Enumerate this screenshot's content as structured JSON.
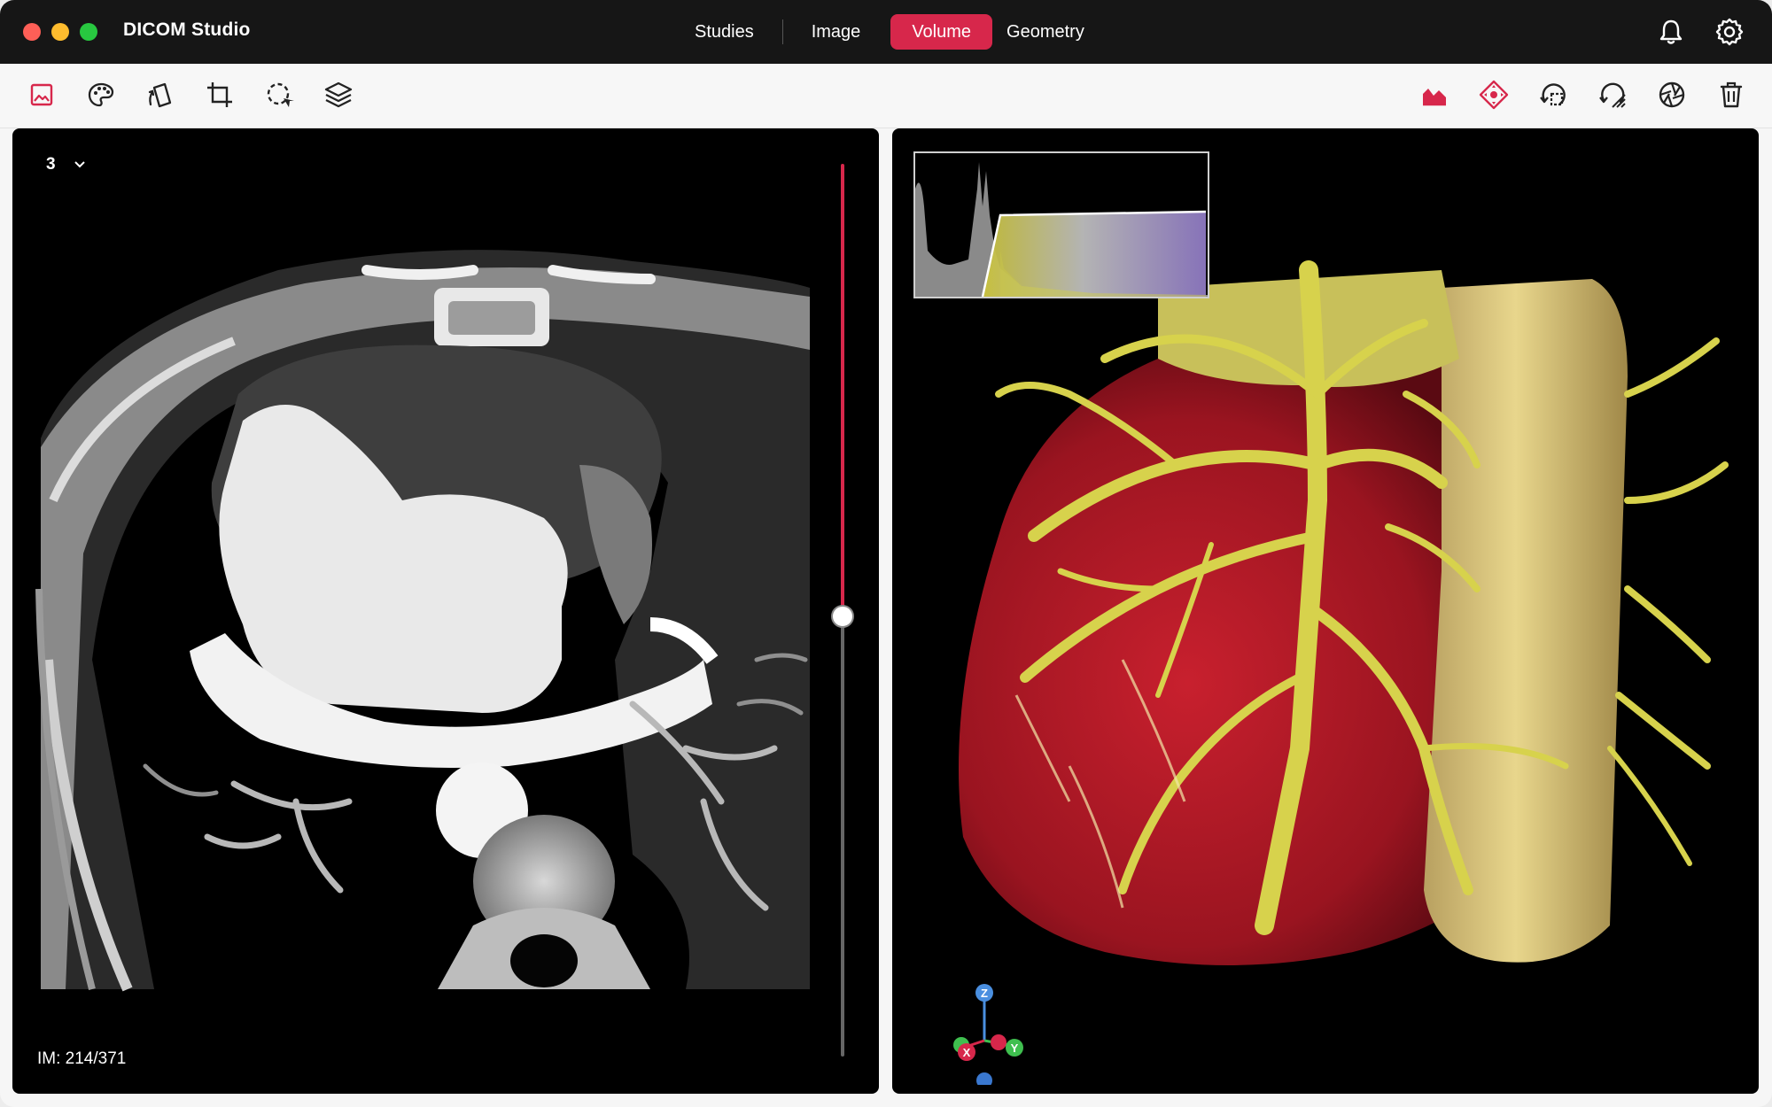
{
  "app": {
    "title": "DICOM Studio"
  },
  "nav": {
    "tabs": [
      {
        "label": "Studies",
        "active": false
      },
      {
        "label": "Image",
        "active": false
      },
      {
        "label": "Volume",
        "active": true
      },
      {
        "label": "Geometry",
        "active": false
      }
    ]
  },
  "header_icons": [
    "bell-icon",
    "gear-icon"
  ],
  "toolbar": {
    "left_tools": [
      "image-icon",
      "palette-icon",
      "rotate-icon",
      "crop-icon",
      "lasso-select-icon",
      "layers-icon"
    ],
    "right_tools": [
      "transfer-function-icon",
      "pan-icon",
      "rotate-view-icon",
      "reset-view-icon",
      "aperture-icon",
      "trash-icon"
    ]
  },
  "left_viewer": {
    "series_number": "3",
    "image_counter": "IM: 214/371",
    "slice_index": 214,
    "slice_total": 371
  },
  "right_viewer": {
    "axis_labels": {
      "z": "Z",
      "x": "X",
      "y": "Y"
    }
  },
  "colors": {
    "accent": "#d7274b",
    "titlebar": "#161616",
    "toolbar": "#f7f7f7"
  }
}
